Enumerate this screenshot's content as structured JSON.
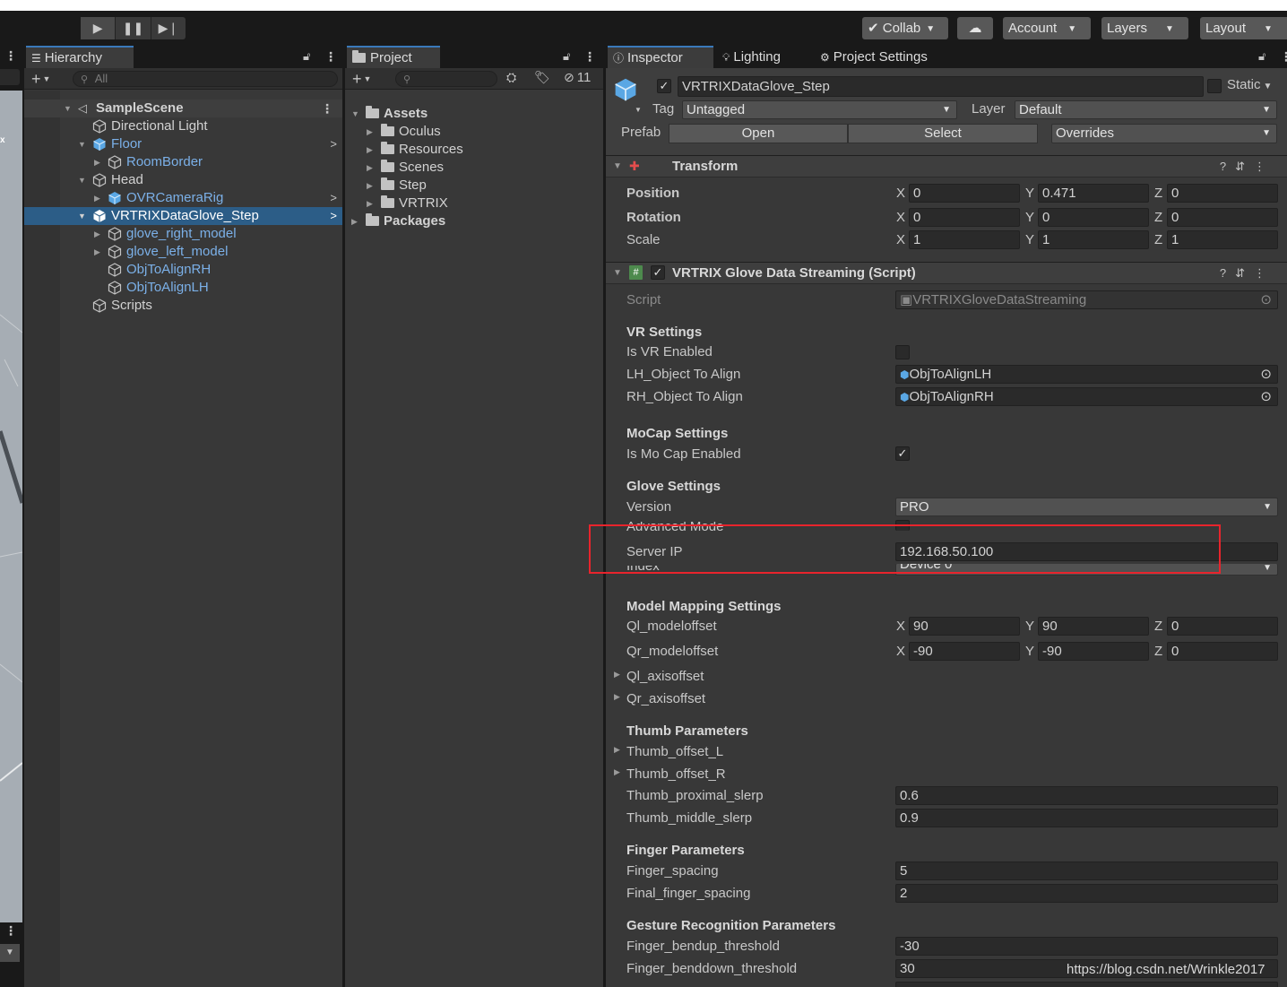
{
  "toolbar": {
    "collab_label": "Collab",
    "account_label": "Account",
    "layers_label": "Layers",
    "layout_label": "Layout"
  },
  "hierarchy": {
    "tab_label": "Hierarchy",
    "search_placeholder": "All",
    "items": [
      {
        "label": "SampleScene"
      },
      {
        "label": "Directional Light"
      },
      {
        "label": "Floor"
      },
      {
        "label": "RoomBorder"
      },
      {
        "label": "Head"
      },
      {
        "label": "OVRCameraRig"
      },
      {
        "label": "VRTRIXDataGlove_Step"
      },
      {
        "label": "glove_right_model"
      },
      {
        "label": "glove_left_model"
      },
      {
        "label": "ObjToAlignRH"
      },
      {
        "label": "ObjToAlignLH"
      },
      {
        "label": "Scripts"
      }
    ]
  },
  "project": {
    "tab_label": "Project",
    "hidden_count": "11",
    "tree": [
      {
        "label": "Assets"
      },
      {
        "label": "Oculus"
      },
      {
        "label": "Resources"
      },
      {
        "label": "Scenes"
      },
      {
        "label": "Step"
      },
      {
        "label": "VRTRIX"
      },
      {
        "label": "Packages"
      }
    ]
  },
  "inspector": {
    "tabs": [
      "Inspector",
      "Lighting",
      "Project Settings"
    ],
    "object_name": "VRTRIXDataGlove_Step",
    "static_label": "Static",
    "tag_label": "Tag",
    "tag_value": "Untagged",
    "layer_label": "Layer",
    "layer_value": "Default",
    "prefab_label": "Prefab",
    "open_label": "Open",
    "select_label": "Select",
    "overrides_label": "Overrides",
    "transform": {
      "title": "Transform",
      "position_label": "Position",
      "rotation_label": "Rotation",
      "scale_label": "Scale",
      "position": [
        "0",
        "0.471",
        "0"
      ],
      "rotation": [
        "0",
        "0",
        "0"
      ],
      "scale": [
        "1",
        "1",
        "1"
      ],
      "axes": [
        "X",
        "Y",
        "Z"
      ]
    },
    "script_component": {
      "title": "VRTRIX Glove Data Streaming (Script)",
      "script_label": "Script",
      "script_value": "VRTRIXGloveDataStreaming",
      "vr_settings": "VR Settings",
      "is_vr_enabled": "Is VR Enabled",
      "lh_label": "LH_Object To Align",
      "lh_value": "ObjToAlignLH",
      "rh_label": "RH_Object To Align",
      "rh_value": "ObjToAlignRH",
      "mocap_settings": "MoCap Settings",
      "is_mocap_enabled": "Is Mo Cap Enabled",
      "glove_settings": "Glove Settings",
      "version_label": "Version",
      "version_value": "PRO",
      "advanced_mode": "Advanced Mode",
      "server_ip_label": "Server IP",
      "server_ip_value": "192.168.50.100",
      "index_label": "Index",
      "index_value": "Device 0",
      "model_mapping": "Model Mapping Settings",
      "ql_modeloffset": "Ql_modeloffset",
      "ql_values": [
        "90",
        "90",
        "0"
      ],
      "qr_modeloffset": "Qr_modeloffset",
      "qr_values": [
        "-90",
        "-90",
        "0"
      ],
      "ql_axisoffset": "Ql_axisoffset",
      "qr_axisoffset": "Qr_axisoffset",
      "thumb_params": "Thumb Parameters",
      "thumb_offset_l": "Thumb_offset_L",
      "thumb_offset_r": "Thumb_offset_R",
      "thumb_proximal_label": "Thumb_proximal_slerp",
      "thumb_proximal_value": "0.6",
      "thumb_middle_label": "Thumb_middle_slerp",
      "thumb_middle_value": "0.9",
      "finger_params": "Finger Parameters",
      "finger_spacing_label": "Finger_spacing",
      "finger_spacing_value": "5",
      "final_finger_label": "Final_finger_spacing",
      "final_finger_value": "2",
      "gesture_params": "Gesture Recognition Parameters",
      "bendup_label": "Finger_bendup_threshold",
      "bendup_value": "-30",
      "benddown_label": "Finger_benddown_threshold",
      "benddown_value": "30"
    }
  },
  "watermark": "https://blog.csdn.net/Wrinkle2017",
  "colors": {
    "selection": "#2c5d87",
    "highlight_box": "#e8242c",
    "prefab_blue": "#7bb0e8"
  }
}
